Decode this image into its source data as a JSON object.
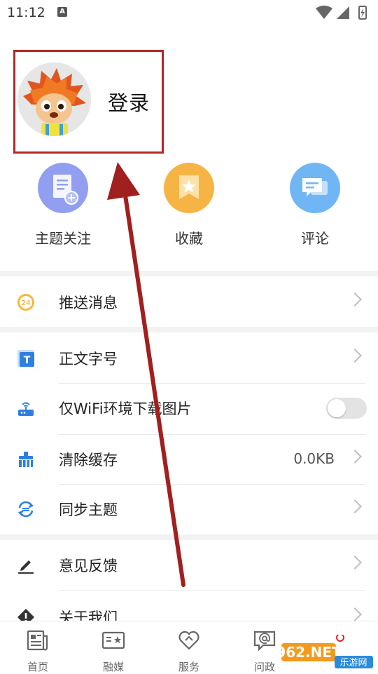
{
  "status_bar": {
    "time": "11:12",
    "indicator": "A"
  },
  "profile": {
    "login_label": "登录"
  },
  "quick_actions": [
    {
      "label": "主题关注",
      "color": "#8f9ff0",
      "icon": "document-add-icon"
    },
    {
      "label": "收藏",
      "color": "#f5b442",
      "icon": "bookmark-star-icon"
    },
    {
      "label": "评论",
      "color": "#6fb6f5",
      "icon": "comment-icon"
    }
  ],
  "menu": {
    "push": {
      "label": "推送消息",
      "badge": "24"
    },
    "font_size": {
      "label": "正文字号",
      "icon_text": "T"
    },
    "wifi_only": {
      "label": "仅WiFi环境下载图片"
    },
    "clear_cache": {
      "label": "清除缓存",
      "value": "0.0KB"
    },
    "sync_theme": {
      "label": "同步主题"
    },
    "feedback": {
      "label": "意见反馈"
    },
    "about": {
      "label": "关于我们"
    }
  },
  "bottom_nav": [
    {
      "label": "首页",
      "icon": "newspaper-icon"
    },
    {
      "label": "融媒",
      "icon": "media-card-icon"
    },
    {
      "label": "服务",
      "icon": "heart-icon"
    },
    {
      "label": "问政",
      "icon": "chat-at-icon"
    }
  ],
  "watermark": {
    "line1": "962.NET",
    "line2": "乐游网"
  },
  "colors": {
    "accent": "#b22727",
    "arrow": "#a11f1f"
  }
}
